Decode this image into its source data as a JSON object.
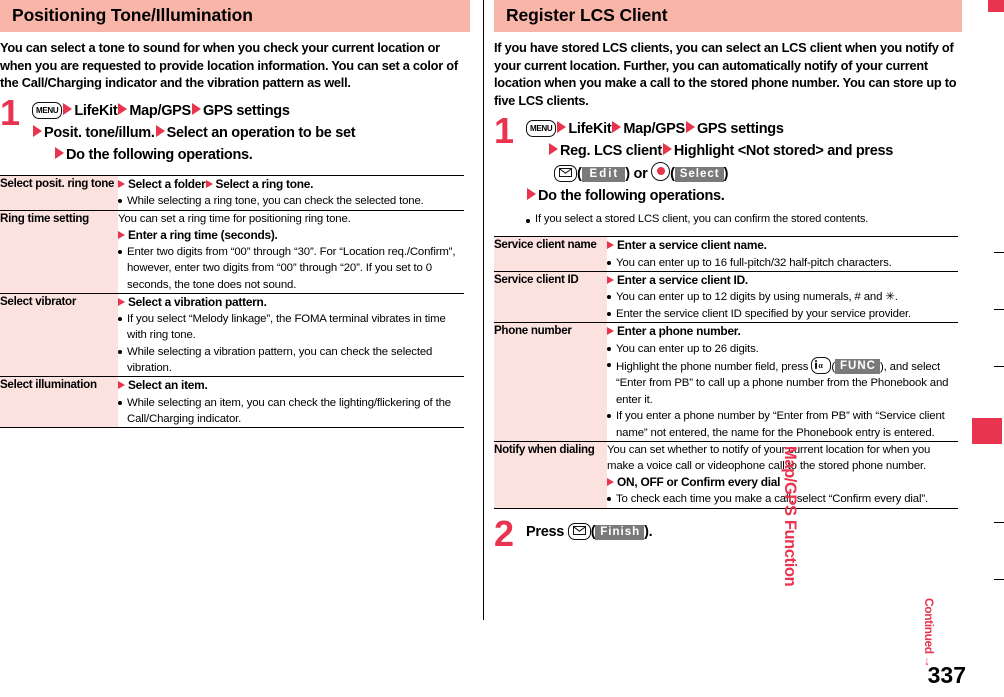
{
  "page": {
    "number": "337",
    "sidebar_label": "Map/GPS Function",
    "continued_label": "Continued",
    "continued_arrow": "→"
  },
  "left": {
    "header": "Positioning Tone/Illumination",
    "intro": "You can select a tone to sound for when you check your current location or when you are requested to provide location information. You can set a color of the Call/Charging indicator and the vibration pattern as well.",
    "step": {
      "number": "1",
      "key_menu": "MENU",
      "line1_a": "LifeKit",
      "line1_b": "Map/GPS",
      "line1_c": "GPS settings",
      "line2_a": "Posit. tone/illum.",
      "line2_b": "Select an operation to be set",
      "line3": "Do the following operations."
    },
    "table": [
      {
        "label": "Select posit. ring tone",
        "bold_steps": [
          "Select a folder",
          "Select a ring tone."
        ],
        "bullets": [
          "While selecting a ring tone, you can check the selected tone."
        ]
      },
      {
        "label": "Ring time setting",
        "lead": "You can set a ring time for positioning ring tone.",
        "bold_steps": [
          "Enter a ring time (seconds)."
        ],
        "bullets": [
          "Enter two digits from “00” through “30”. For “Location req./Confirm”, however, enter two digits from “00” through “20”. If you set to 0 seconds, the tone does not sound."
        ]
      },
      {
        "label": "Select vibrator",
        "bold_steps": [
          "Select a vibration pattern."
        ],
        "bullets": [
          "If you select “Melody linkage”, the FOMA terminal vibrates in time with ring tone.",
          "While selecting a vibration pattern, you can check the selected vibration."
        ]
      },
      {
        "label": "Select illumination",
        "bold_steps": [
          "Select an item."
        ],
        "bullets": [
          "While selecting an item, you can check the lighting/flickering of the Call/Charging indicator."
        ]
      }
    ]
  },
  "right": {
    "header": "Register LCS Client",
    "intro": "If you have stored LCS clients, you can select an LCS client when you notify of your current location. Further, you can automatically notify of your current location when you make a call to the stored phone number. You can store up to five LCS clients.",
    "step1": {
      "number": "1",
      "key_menu": "MENU",
      "line1_a": "LifeKit",
      "line1_b": "Map/GPS",
      "line1_c": "GPS settings",
      "line2_a": "Reg. LCS client",
      "line2_b": "Highlight <Not stored> and press",
      "softkey_edit": "Edit",
      "or_label": ") or ",
      "softkey_select": "Select",
      "line4": "Do the following operations.",
      "note": "If you select a stored LCS client, you can confirm the stored contents."
    },
    "step2": {
      "number": "2",
      "press_label": "Press",
      "softkey_finish": "Finish",
      "suffix": ")."
    },
    "table": [
      {
        "label": "Service client name",
        "bold_steps": [
          "Enter a service client name."
        ],
        "bullets": [
          "You can enter up to 16 full-pitch/32 half-pitch characters."
        ]
      },
      {
        "label": "Service client ID",
        "bold_steps": [
          "Enter a service client ID."
        ],
        "bullets": [
          "You can enter up to 12 digits by using numerals, # and ✳.",
          "Enter the service client ID specified by your service provider."
        ]
      },
      {
        "label": "Phone number",
        "bold_steps": [
          "Enter a phone number."
        ],
        "bullets": [
          "You can enter up to 26 digits."
        ],
        "bullet_func_pre": "Highlight the phone number field, press ",
        "bullet_func_key": "FUNC",
        "bullet_func_post": "), and select “Enter from PB” to call up a phone number from the Phonebook and enter it.",
        "bullets_tail": [
          "If you enter a phone number by “Enter from PB” with “Service client name” not entered, the name for the Phonebook entry is entered."
        ]
      },
      {
        "label": "Notify when dialing",
        "lead": "You can set whether to notify of your current location for when you make a voice call or videophone call to the stored phone number.",
        "bold_steps": [
          "ON, OFF or Confirm every dial"
        ],
        "bullets": [
          "To check each time you make a call, select “Confirm every dial”."
        ]
      }
    ]
  },
  "colors": {
    "header_bg": "#f9b6a8",
    "label_bg": "#fbe2df",
    "accent_red": "#e8344e",
    "softkey_bg": "#7a7a7a"
  }
}
